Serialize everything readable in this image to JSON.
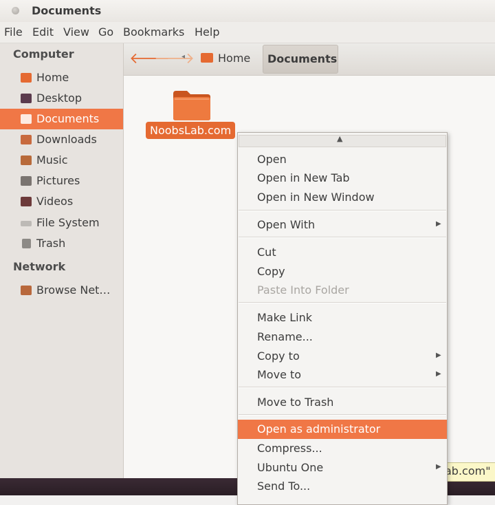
{
  "window": {
    "title": "Documents"
  },
  "menubar": [
    "File",
    "Edit",
    "View",
    "Go",
    "Bookmarks",
    "Help"
  ],
  "sidebar": {
    "computer_heading": "Computer",
    "items": [
      {
        "label": "Home",
        "icon": "home-folder-icon",
        "color": "#e56a32"
      },
      {
        "label": "Desktop",
        "icon": "desktop-icon",
        "color": "#5b3a4d"
      },
      {
        "label": "Documents",
        "icon": "documents-icon",
        "color": "#ffffff",
        "selected": true
      },
      {
        "label": "Downloads",
        "icon": "downloads-icon",
        "color": "#c86a3e"
      },
      {
        "label": "Music",
        "icon": "music-icon",
        "color": "#b86a3a"
      },
      {
        "label": "Pictures",
        "icon": "pictures-icon",
        "color": "#7a7470"
      },
      {
        "label": "Videos",
        "icon": "videos-icon",
        "color": "#6d3a3a"
      },
      {
        "label": "File System",
        "icon": "file-system-icon",
        "color": "#bdbab6"
      },
      {
        "label": "Trash",
        "icon": "trash-icon",
        "color": "#8d8a86"
      }
    ],
    "network_heading": "Network",
    "network_items": [
      {
        "label": "Browse Net…",
        "icon": "network-icon",
        "color": "#b8683c"
      }
    ]
  },
  "toolbar": {
    "back": "🡐",
    "forward": "🡒",
    "crumb_home": "Home",
    "crumb_current": "Documents"
  },
  "content": {
    "folder_label": "NoobsLab.com",
    "tooltip": "ab.com\""
  },
  "context_menu": [
    {
      "label": "Open"
    },
    {
      "label": "Open in New Tab"
    },
    {
      "label": "Open in New Window"
    },
    {
      "sep": true
    },
    {
      "label": "Open With",
      "submenu": true
    },
    {
      "sep": true
    },
    {
      "label": "Cut"
    },
    {
      "label": "Copy"
    },
    {
      "label": "Paste Into Folder",
      "disabled": true
    },
    {
      "sep": true
    },
    {
      "label": "Make Link"
    },
    {
      "label": "Rename..."
    },
    {
      "label": "Copy to",
      "submenu": true
    },
    {
      "label": "Move to",
      "submenu": true
    },
    {
      "sep": true
    },
    {
      "label": "Move to Trash"
    },
    {
      "sep": true
    },
    {
      "label": "Open as administrator",
      "highlighted": true
    },
    {
      "label": "Compress..."
    },
    {
      "label": "Ubuntu One",
      "submenu": true
    },
    {
      "label": "Send To..."
    }
  ],
  "colors": {
    "accent": "#f07746",
    "folder": "#e56a32"
  }
}
